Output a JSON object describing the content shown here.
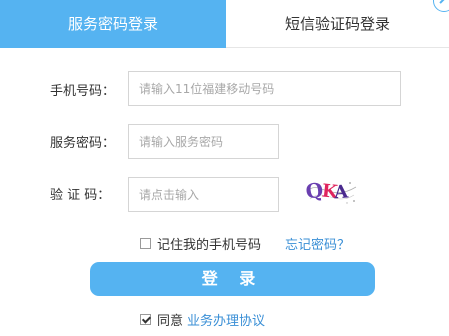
{
  "tabs": [
    {
      "label": "服务密码登录",
      "active": true
    },
    {
      "label": "短信验证码登录",
      "active": false
    }
  ],
  "form": {
    "phone": {
      "label": "手机号码：",
      "placeholder": "请输入11位福建移动号码",
      "value": ""
    },
    "password": {
      "label": "服务密码：",
      "placeholder": "请输入服务密码",
      "value": ""
    },
    "captcha": {
      "label": "验 证 码：",
      "placeholder": "请点击输入",
      "value": "",
      "image_text": "QKA"
    }
  },
  "remember": {
    "label": "记住我的手机号码",
    "checked": false
  },
  "forgot_password": "忘记密码？",
  "login_button": "登 录",
  "agree": {
    "prefix": "同意",
    "link": "业务办理协议",
    "checked": true
  },
  "colors": {
    "accent": "#55b3f1",
    "link": "#3a8fd6",
    "captcha_red": "#e0245e",
    "captcha_purple": "#6a3fb0"
  },
  "icons": [
    "close-icon",
    "captcha-image",
    "checkbox"
  ]
}
